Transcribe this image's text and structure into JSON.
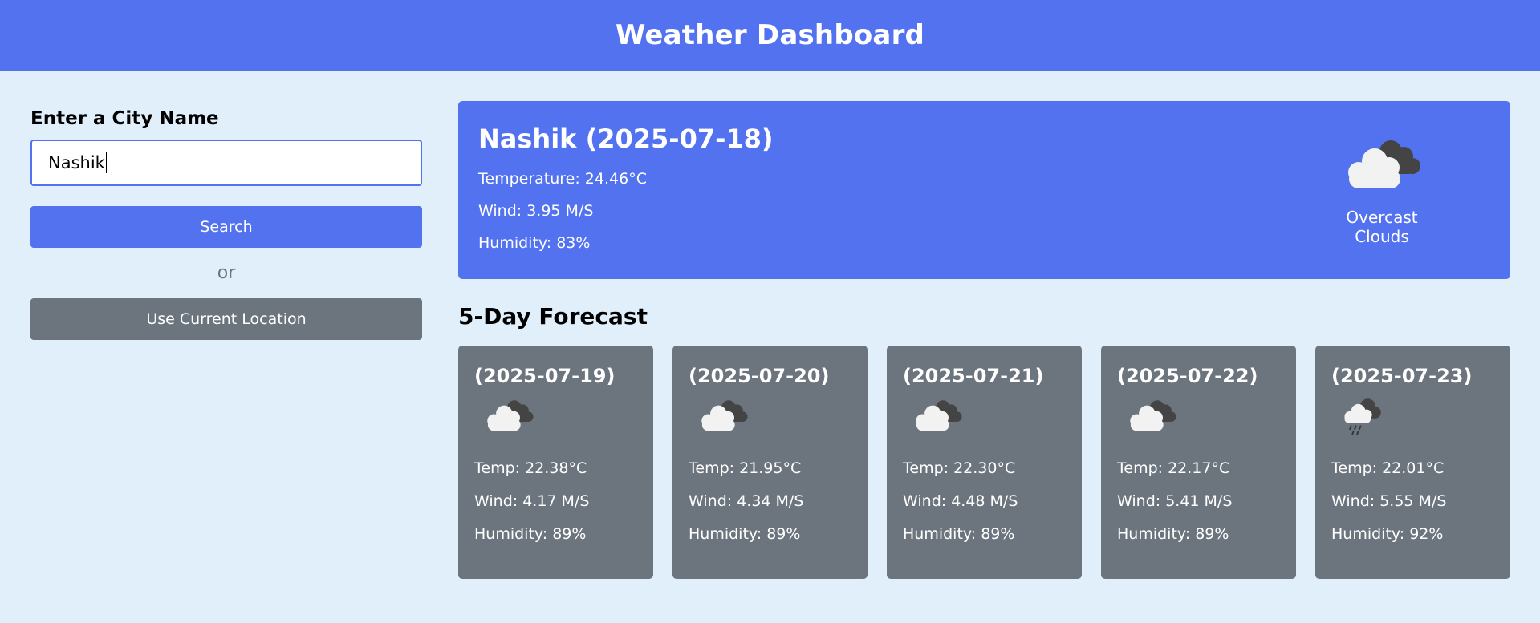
{
  "header": {
    "title": "Weather Dashboard"
  },
  "search": {
    "label": "Enter a City Name",
    "value": "Nashik",
    "search_label": "Search",
    "separator": "or",
    "location_label": "Use Current Location"
  },
  "current": {
    "title": "Nashik (2025-07-18)",
    "temperature": "Temperature: 24.46°C",
    "wind": "Wind: 3.95 M/S",
    "humidity": "Humidity: 83%",
    "icon": "overcast-clouds-icon",
    "condition": "Overcast Clouds"
  },
  "forecast": {
    "title": "5-Day Forecast",
    "days": [
      {
        "date": "(2025-07-19)",
        "icon": "broken-clouds-icon",
        "temp": "Temp: 22.38°C",
        "wind": "Wind: 4.17 M/S",
        "humidity": "Humidity: 89%"
      },
      {
        "date": "(2025-07-20)",
        "icon": "broken-clouds-icon",
        "temp": "Temp: 21.95°C",
        "wind": "Wind: 4.34 M/S",
        "humidity": "Humidity: 89%"
      },
      {
        "date": "(2025-07-21)",
        "icon": "broken-clouds-icon",
        "temp": "Temp: 22.30°C",
        "wind": "Wind: 4.48 M/S",
        "humidity": "Humidity: 89%"
      },
      {
        "date": "(2025-07-22)",
        "icon": "broken-clouds-icon",
        "temp": "Temp: 22.17°C",
        "wind": "Wind: 5.41 M/S",
        "humidity": "Humidity: 89%"
      },
      {
        "date": "(2025-07-23)",
        "icon": "rain-icon",
        "temp": "Temp: 22.01°C",
        "wind": "Wind: 5.55 M/S",
        "humidity": "Humidity: 92%"
      }
    ]
  },
  "colors": {
    "accent": "#5372f0",
    "card": "#6c757d",
    "background": "#e1effb"
  }
}
